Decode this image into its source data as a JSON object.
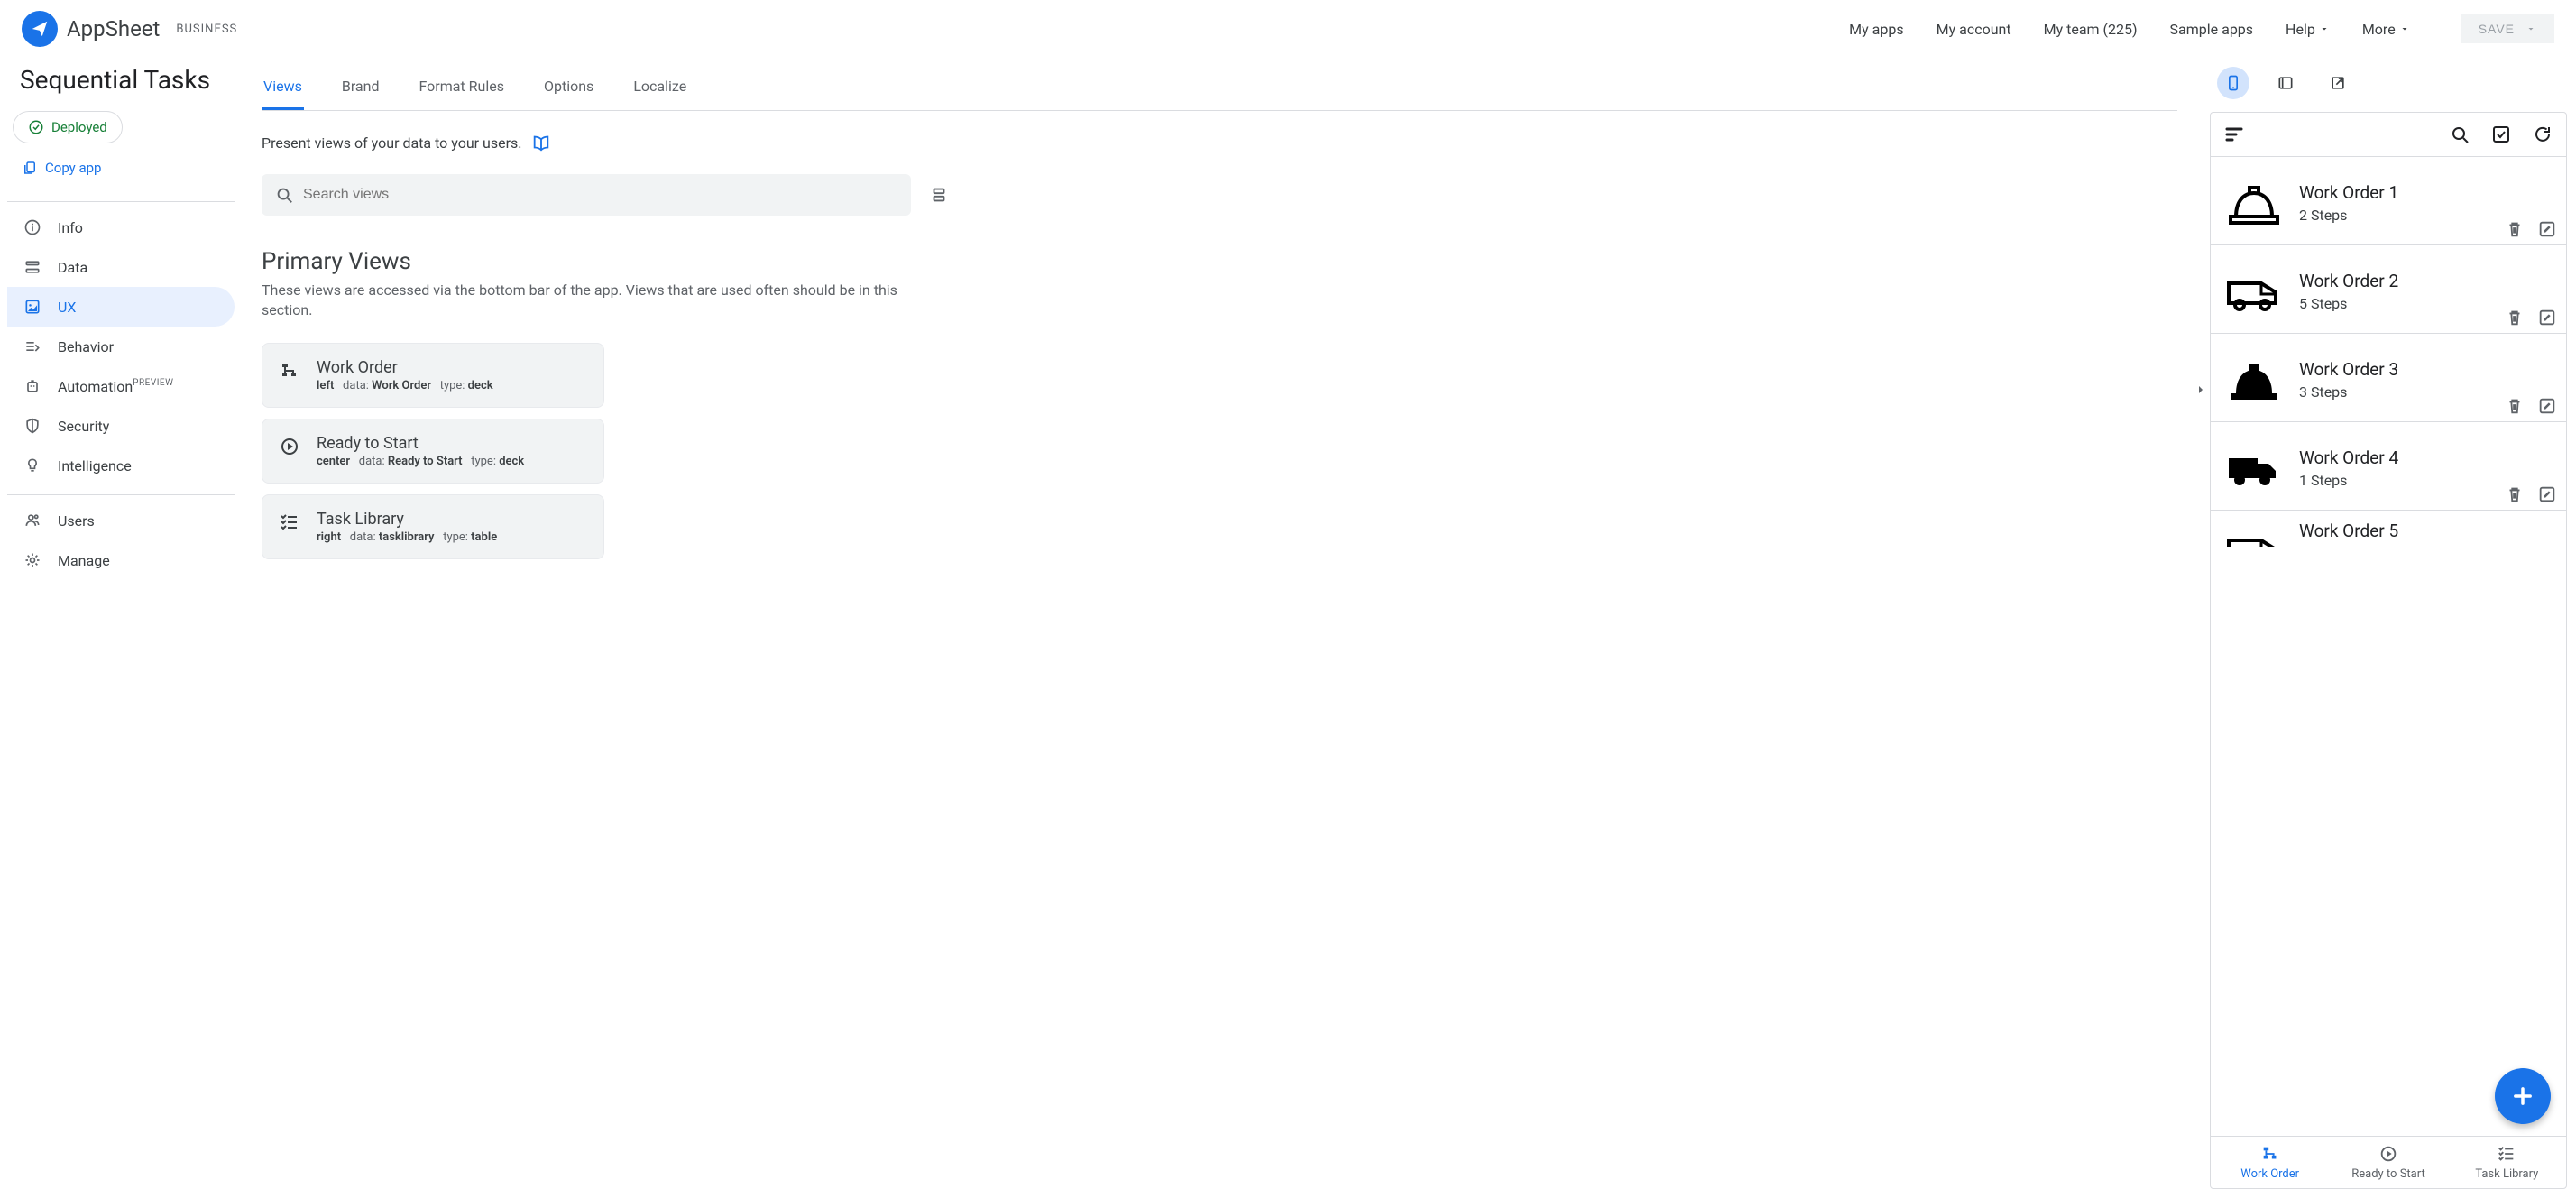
{
  "brand": {
    "name": "AppSheet",
    "sub": "BUSINESS"
  },
  "topNav": {
    "myApps": "My apps",
    "myAccount": "My account",
    "myTeam": "My team (225)",
    "sampleApps": "Sample apps",
    "help": "Help",
    "more": "More",
    "save": "SAVE"
  },
  "appTitle": "Sequential Tasks",
  "status": {
    "deployed": "Deployed",
    "copy": "Copy app"
  },
  "sidebar": {
    "info": "Info",
    "data": "Data",
    "ux": "UX",
    "behavior": "Behavior",
    "automation": "Automation",
    "automationBadge": "PREVIEW",
    "security": "Security",
    "intelligence": "Intelligence",
    "users": "Users",
    "manage": "Manage"
  },
  "uxTabs": {
    "views": "Views",
    "brand": "Brand",
    "format": "Format Rules",
    "options": "Options",
    "localize": "Localize"
  },
  "hint": "Present views of your data to your users.",
  "searchPlaceholder": "Search views",
  "sectionTitle": "Primary Views",
  "sectionDesc": "These views are accessed via the bottom bar of the app. Views that are used often should be in this section.",
  "cards": [
    {
      "name": "Work Order",
      "pos": "left",
      "data": "Work Order",
      "type": "deck"
    },
    {
      "name": "Ready to Start",
      "pos": "center",
      "data": "Ready to Start",
      "type": "deck"
    },
    {
      "name": "Task Library",
      "pos": "right",
      "data": "tasklibrary",
      "type": "table"
    }
  ],
  "workOrders": [
    {
      "title": "Work Order 1",
      "sub": "2 Steps",
      "icon": "hardhat-line"
    },
    {
      "title": "Work Order 2",
      "sub": "5 Steps",
      "icon": "van-line"
    },
    {
      "title": "Work Order 3",
      "sub": "3 Steps",
      "icon": "hardhat-solid"
    },
    {
      "title": "Work Order 4",
      "sub": "1 Steps",
      "icon": "truck-solid"
    },
    {
      "title": "Work Order 5",
      "sub": "",
      "icon": "van-line-partial"
    }
  ],
  "bottomNav": {
    "work": "Work Order",
    "ready": "Ready to Start",
    "library": "Task Library"
  }
}
